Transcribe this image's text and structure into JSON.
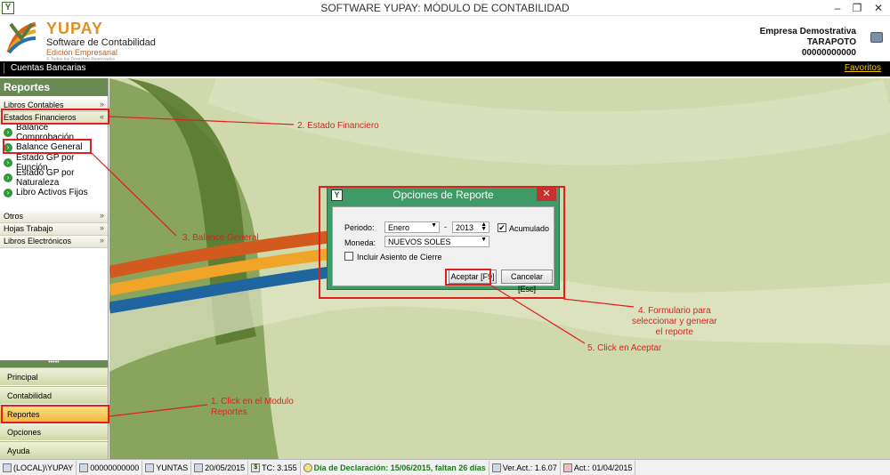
{
  "window": {
    "title": "SOFTWARE YUPAY: MÓDULO DE CONTABILIDAD",
    "app_icon": "yupay-logo-icon",
    "minimize": "–",
    "restore": "❐",
    "close": "✕"
  },
  "brand": {
    "name": "YUPAY",
    "subtitle": "Software de Contabilidad",
    "edition": "Edición Empresarial",
    "tagline": "© Todos los Derechos Reservados"
  },
  "company": {
    "name": "Empresa Demostrativa",
    "city": "TARAPOTO",
    "ruc": "00000000000"
  },
  "navbar": {
    "breadcrumb": "Cuentas Bancarias",
    "favorites": "Favoritos"
  },
  "sidebar": {
    "title": "Reportes",
    "groups": [
      {
        "label": "Libros Contables",
        "chevron": "»"
      },
      {
        "label": "Estados Financieros",
        "chevron": "«"
      }
    ],
    "items": [
      {
        "label": "Balance Comprobación"
      },
      {
        "label": "Balance General"
      },
      {
        "label": "Estado GP por Función"
      },
      {
        "label": "Estado GP por Naturaleza"
      },
      {
        "label": "Libro Activos Fijos"
      }
    ],
    "groups2": [
      {
        "label": "Otros",
        "chevron": "»"
      },
      {
        "label": "Hojas Trabajo",
        "chevron": "»"
      },
      {
        "label": "Libros Electrónicos",
        "chevron": "»"
      }
    ],
    "dots": "•••••",
    "modules": [
      {
        "label": "Principal"
      },
      {
        "label": "Contabilidad"
      },
      {
        "label": "Reportes"
      },
      {
        "label": "Opciones"
      },
      {
        "label": "Ayuda"
      }
    ]
  },
  "dialog": {
    "title": "Opciones de Reporte",
    "close": "✕",
    "periodo_label": "Periodo:",
    "periodo_value": "Enero",
    "dash": "-",
    "year_value": "2013",
    "acumulado_label": "Acumulado",
    "acumulado_checked": "✔",
    "moneda_label": "Moneda:",
    "moneda_value": "NUEVOS SOLES",
    "incluir_label": "Incluir Asiento de Cierre",
    "accept": "Aceptar [F9]",
    "cancel": "Cancelar [Esc]"
  },
  "annotations": {
    "a1": "1. Click en el Modulo\nReportes",
    "a2": "2. Estado Financiero",
    "a3": "3. Balance General",
    "a4": "4. Formulario para\nseleccionar y generar\nel reporte",
    "a5": "5.  Click en Aceptar"
  },
  "statusbar": {
    "server": "(LOCAL)\\YUPAY",
    "ruc": "00000000000",
    "user": "YUNTAS",
    "date": "20/05/2015",
    "tc": "TC: 3.155",
    "declaracion": "Día de Declaración: 15/06/2015, faltan 26 días",
    "version": "Ver.Act.: 1.6.07",
    "actualizacion": "Act.: 01/04/2015"
  },
  "colors": {
    "accent_green": "#6a8a54",
    "annotation_red": "#e02020",
    "dialog_green": "#3e9a66",
    "status_green": "#1a7a1a"
  }
}
